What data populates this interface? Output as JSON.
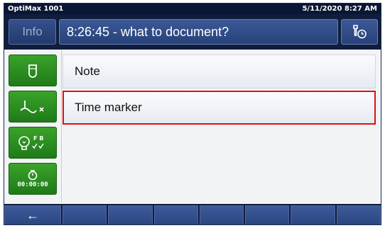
{
  "statusbar": {
    "device_name": "OptiMax 1001",
    "datetime": "5/11/2020 8:27 AM"
  },
  "header": {
    "info_label": "Info",
    "title": "8:26:45 - what to document?",
    "tool_icon": "wrench-clock-icon"
  },
  "actions": {
    "buttons": [
      {
        "icon": "beaker-icon"
      },
      {
        "icon": "stirrer-off-icon"
      },
      {
        "icon": "bulb-fb-icon",
        "sub_top": "F B"
      },
      {
        "icon": "timer-icon",
        "time_label": "00:00:00"
      }
    ]
  },
  "list": {
    "items": [
      {
        "label": "Note",
        "selected": false
      },
      {
        "label": "Time marker",
        "selected": true
      }
    ]
  },
  "bottombar": {
    "back_icon": "←",
    "empty_buttons": 7
  },
  "colors": {
    "header_bg": "#101d3c",
    "accent_blue": "#2d4a86",
    "action_green": "#2a8f21",
    "selection_red": "#e01010"
  }
}
